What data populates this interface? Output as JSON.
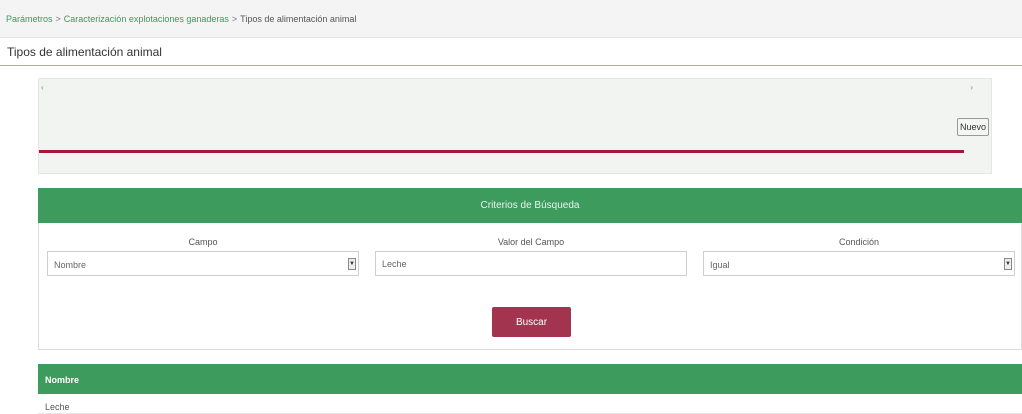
{
  "breadcrumb": {
    "items": [
      "Parámetros",
      "Caracterización explotaciones ganaderas",
      "Tipos de alimentación animal"
    ],
    "separator": ">"
  },
  "page": {
    "title": "Tipos de alimentación animal"
  },
  "top_panel": {
    "left_marker": "‹",
    "right_marker": "›",
    "new_button": "Nuevo"
  },
  "search": {
    "header": "Criterios de Búsqueda",
    "field_label": "Campo",
    "field_value": "Nombre",
    "value_label": "Valor del Campo",
    "value_value": "Leche",
    "condition_label": "Condición",
    "condition_value": "Igual",
    "search_button": "Buscar"
  },
  "results": {
    "columns": [
      "Nombre"
    ],
    "rows": [
      [
        "Leche"
      ]
    ]
  },
  "colors": {
    "accent_green": "#3d9b5d",
    "accent_red": "#a2193a",
    "button_red": "#a3344f"
  }
}
